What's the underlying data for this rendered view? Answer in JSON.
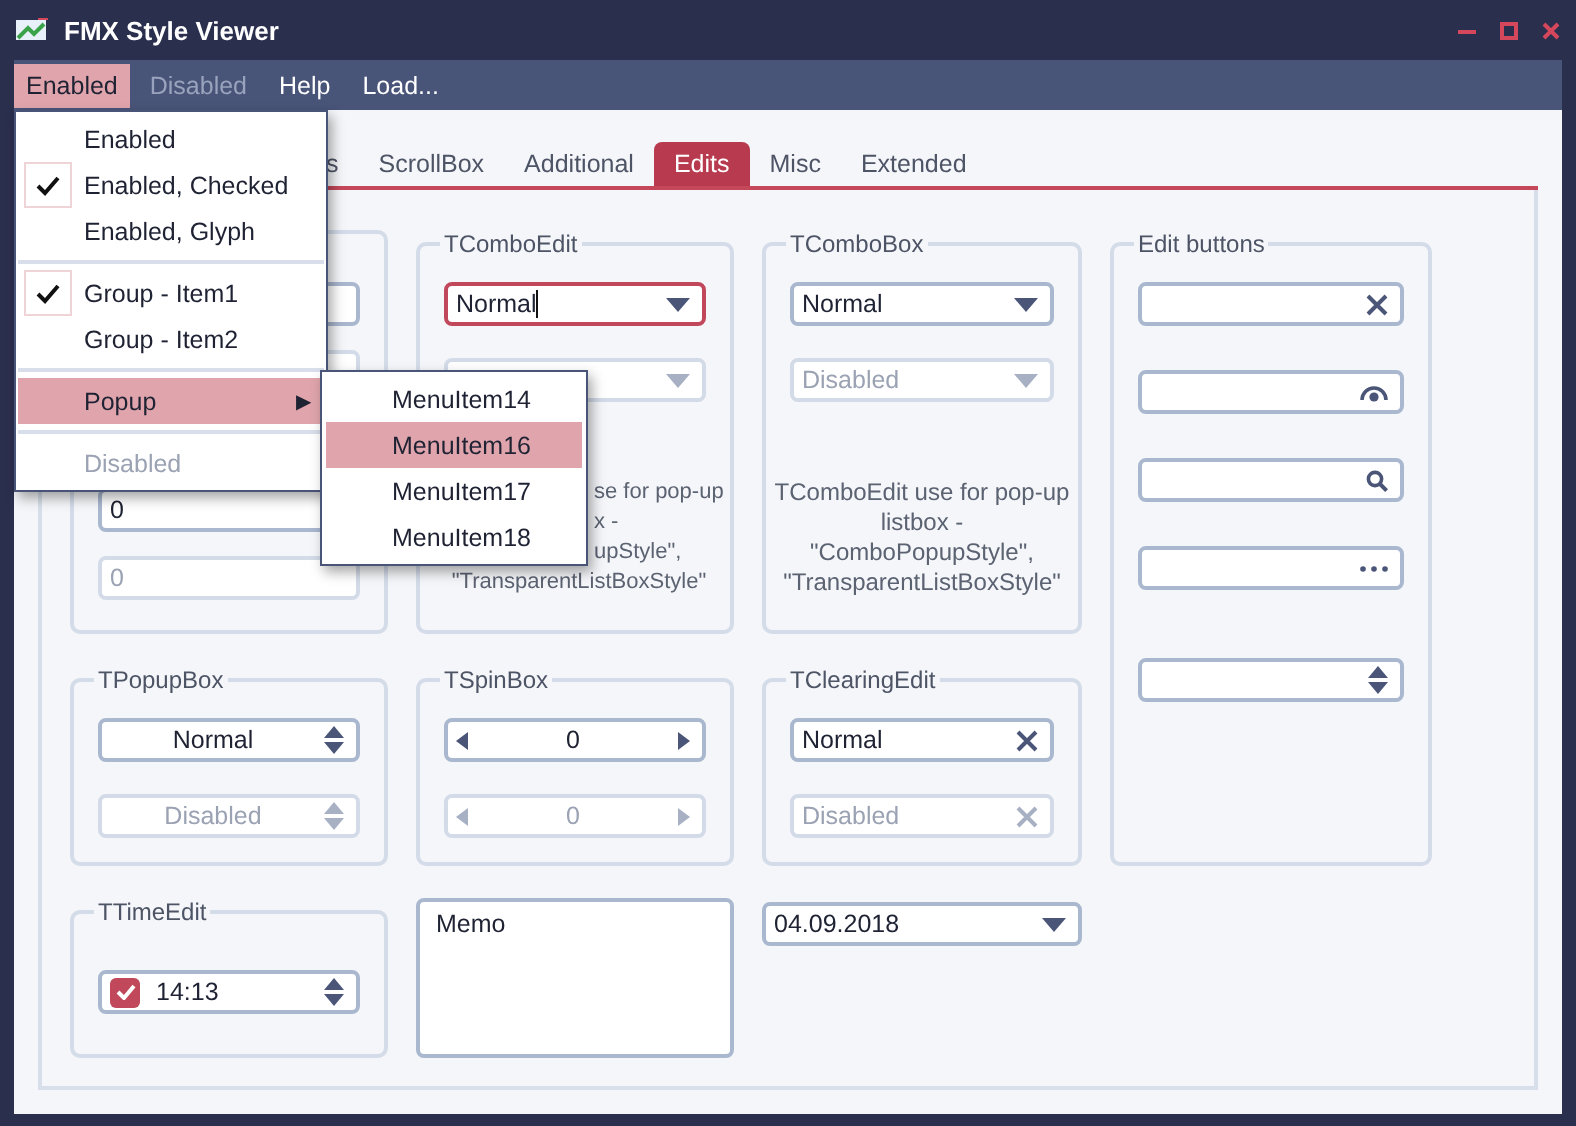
{
  "window": {
    "title": "FMX Style Viewer"
  },
  "menu_bar": [
    {
      "label": "Enabled",
      "selected": true,
      "disabled": false
    },
    {
      "label": "Disabled",
      "selected": false,
      "disabled": true
    },
    {
      "label": "Help",
      "selected": false,
      "disabled": false
    },
    {
      "label": "Load...",
      "selected": false,
      "disabled": false
    }
  ],
  "menu": [
    {
      "kind": "item",
      "label": "Enabled",
      "checked": false,
      "highlighted": false,
      "disabled": false
    },
    {
      "kind": "item",
      "label": "Enabled, Checked",
      "checked": true,
      "highlighted": false,
      "disabled": false
    },
    {
      "kind": "item",
      "label": "Enabled, Glyph",
      "checked": false,
      "highlighted": false,
      "disabled": false
    },
    {
      "kind": "separator"
    },
    {
      "kind": "item",
      "label": "Group - Item1",
      "checked": true,
      "highlighted": false,
      "disabled": false
    },
    {
      "kind": "item",
      "label": "Group - Item2",
      "checked": false,
      "highlighted": false,
      "disabled": false
    },
    {
      "kind": "separator"
    },
    {
      "kind": "submenu",
      "label": "Popup",
      "checked": false,
      "highlighted": true,
      "disabled": false,
      "arrow": "▶"
    },
    {
      "kind": "separator"
    },
    {
      "kind": "item",
      "label": "Disabled",
      "checked": false,
      "highlighted": false,
      "disabled": true
    }
  ],
  "submenu": [
    {
      "label": "MenuItem14",
      "highlighted": false
    },
    {
      "label": "MenuItem16",
      "highlighted": true
    },
    {
      "label": "MenuItem17",
      "highlighted": false
    },
    {
      "label": "MenuItem18",
      "highlighted": false
    }
  ],
  "tabs": [
    {
      "label": "s",
      "selected": false
    },
    {
      "label": "ScrollBox",
      "selected": false
    },
    {
      "label": "Additional",
      "selected": false
    },
    {
      "label": "Edits",
      "selected": true
    },
    {
      "label": "Misc",
      "selected": false
    },
    {
      "label": "Extended",
      "selected": false
    }
  ],
  "panels": [
    {
      "kind": "group",
      "controls": [
        {
          "kind": "edit",
          "disabled": false
        },
        {
          "kind": "edit",
          "disabled": true
        },
        {
          "kind": "edit",
          "value": "0",
          "disabled": false
        },
        {
          "kind": "edit",
          "value": "0",
          "disabled": true
        }
      ]
    },
    {
      "kind": "group",
      "title": "TComboEdit",
      "controls": [
        {
          "kind": "combo_edit",
          "value": "Normal",
          "focused": true,
          "disabled": false
        },
        {
          "kind": "combo_edit",
          "focused": false,
          "disabled": true
        },
        {
          "kind": "partial_note",
          "lines": [
            "se for pop-up",
            "x -",
            "upStyle\",",
            "\"TransparentListBoxStyle\""
          ]
        }
      ]
    },
    {
      "kind": "group",
      "title": "TComboBox",
      "controls": [
        {
          "kind": "combo_box",
          "value": "Normal",
          "disabled": false
        },
        {
          "kind": "combo_box",
          "value": "Disabled",
          "disabled": true
        },
        {
          "kind": "note",
          "text": "TComboEdit use for pop-up listbox - \"ComboPopupStyle\", \"TransparentListBoxStyle\""
        }
      ]
    },
    {
      "kind": "group",
      "title": "Edit buttons",
      "controls": [
        {
          "kind": "clear_edit"
        },
        {
          "kind": "eye_edit"
        },
        {
          "kind": "search_edit"
        },
        {
          "kind": "ellipsis_edit"
        },
        {
          "kind": "spin_edit"
        }
      ]
    },
    {
      "kind": "group",
      "title": "TPopupBox",
      "controls": [
        {
          "kind": "popup_box",
          "value": "Normal",
          "disabled": false
        },
        {
          "kind": "popup_box",
          "value": "Disabled",
          "disabled": true
        }
      ]
    },
    {
      "kind": "group",
      "title": "TSpinBox",
      "controls": [
        {
          "kind": "spin_box",
          "value": "0",
          "disabled": false
        },
        {
          "kind": "spin_box",
          "value": "0",
          "disabled": true
        }
      ]
    },
    {
      "kind": "group",
      "title": "TClearingEdit",
      "controls": [
        {
          "kind": "clearing_edit",
          "value": "Normal",
          "disabled": false
        },
        {
          "kind": "clearing_edit",
          "value": "Disabled",
          "disabled": true
        }
      ]
    },
    {
      "kind": "group",
      "title": "TTimeEdit",
      "controls": [
        {
          "kind": "time_edit",
          "value": "14:13",
          "checked": true
        }
      ]
    },
    {
      "kind": "memo",
      "text": "Memo"
    },
    {
      "kind": "date_edit",
      "value": "04.09.2018"
    }
  ]
}
